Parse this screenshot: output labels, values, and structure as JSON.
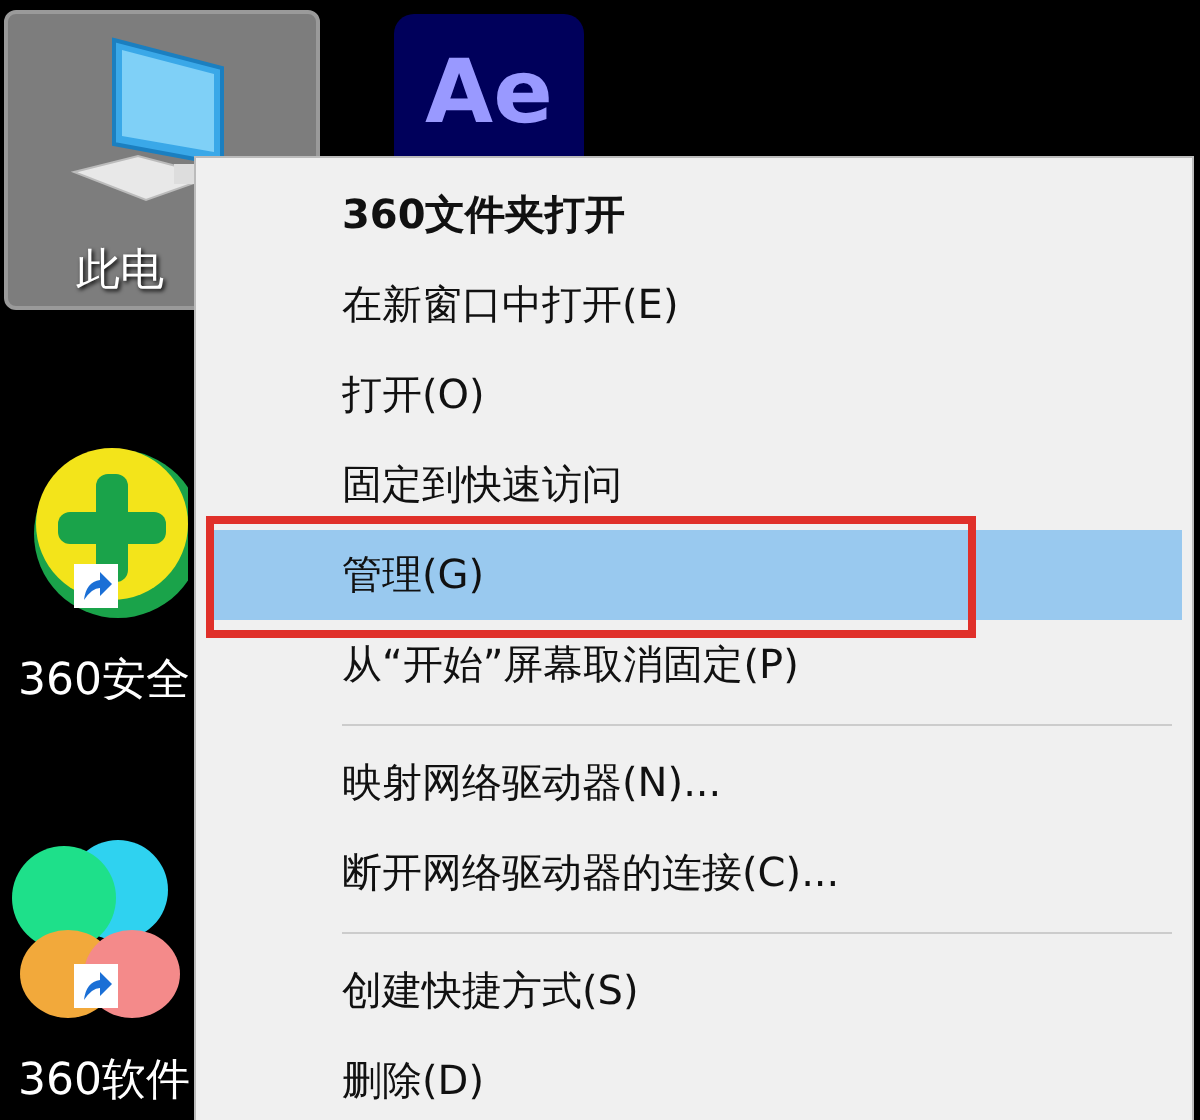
{
  "desktop_icons": [
    {
      "kind": "computer",
      "label": "此电",
      "selected": true,
      "shortcut": false
    },
    {
      "kind": "ae",
      "logo": "Ae",
      "selected": false,
      "shortcut": false
    },
    {
      "kind": "guard",
      "label": "360安全",
      "selected": false,
      "shortcut": true
    },
    {
      "kind": "flower",
      "label": "360软件",
      "selected": false,
      "shortcut": true
    }
  ],
  "context_menu": {
    "items": [
      {
        "kind": "item",
        "label": "360文件夹打开",
        "bold": true,
        "selected": false,
        "annotated": false
      },
      {
        "kind": "item",
        "label": "在新窗口中打开(E)",
        "bold": false,
        "selected": false,
        "annotated": false
      },
      {
        "kind": "item",
        "label": "打开(O)",
        "bold": false,
        "selected": false,
        "annotated": false
      },
      {
        "kind": "item",
        "label": "固定到快速访问",
        "bold": false,
        "selected": false,
        "annotated": false
      },
      {
        "kind": "item",
        "label": "管理(G)",
        "bold": false,
        "selected": true,
        "annotated": true
      },
      {
        "kind": "item",
        "label": "从“开始”屏幕取消固定(P)",
        "bold": false,
        "selected": false,
        "annotated": false
      },
      {
        "kind": "separator"
      },
      {
        "kind": "item",
        "label": "映射网络驱动器(N)...",
        "bold": false,
        "selected": false,
        "annotated": false
      },
      {
        "kind": "item",
        "label": "断开网络驱动器的连接(C)...",
        "bold": false,
        "selected": false,
        "annotated": false
      },
      {
        "kind": "separator"
      },
      {
        "kind": "item",
        "label": "创建快捷方式(S)",
        "bold": false,
        "selected": false,
        "annotated": false
      },
      {
        "kind": "item",
        "label": "删除(D)",
        "bold": false,
        "selected": false,
        "annotated": false
      }
    ]
  }
}
